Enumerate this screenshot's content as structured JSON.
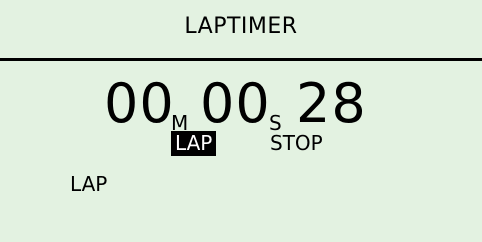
{
  "header": {
    "title": "LAPTIMER"
  },
  "timer": {
    "minutes": "00",
    "minutes_unit": "M",
    "seconds": "00",
    "seconds_unit": "S",
    "centiseconds": "28"
  },
  "controls": {
    "mode_label": "LAP",
    "state_label": "STOP"
  },
  "laps": {
    "label": "LAP"
  },
  "colors": {
    "background": "#e3f2e1",
    "text": "#000000",
    "highlight_bg": "#000000",
    "highlight_text": "#ffffff"
  }
}
